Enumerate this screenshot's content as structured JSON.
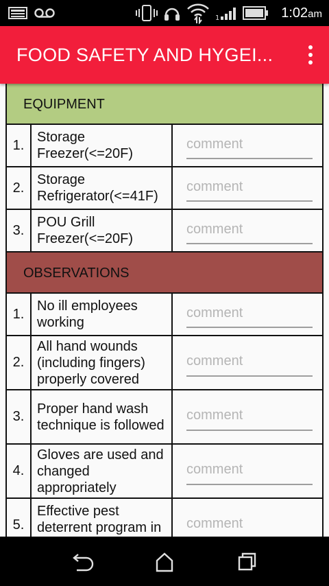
{
  "status_bar": {
    "time": "1:02",
    "ampm": "am"
  },
  "app_bar": {
    "title": "FOOD SAFETY AND HYGEI..."
  },
  "sections": [
    {
      "title": "EQUIPMENT",
      "color": "#b3cc82",
      "items": [
        {
          "num": "1.",
          "text": "Storage Freezer(<=20F)",
          "comment_placeholder": "comment",
          "comment_value": ""
        },
        {
          "num": "2.",
          "text": "Storage Refrigerator(<=41F)",
          "comment_placeholder": "comment",
          "comment_value": ""
        },
        {
          "num": "3.",
          "text": "POU Grill Freezer(<=20F)",
          "comment_placeholder": "comment",
          "comment_value": ""
        }
      ]
    },
    {
      "title": "OBSERVATIONS",
      "color": "#a04d49",
      "items": [
        {
          "num": "1.",
          "text": "No ill employees working",
          "comment_placeholder": "comment",
          "comment_value": ""
        },
        {
          "num": "2.",
          "text": "All hand wounds (including fingers) properly covered",
          "comment_placeholder": "comment",
          "comment_value": ""
        },
        {
          "num": "3.",
          "text": "Proper hand wash technique is followed",
          "comment_placeholder": "comment",
          "comment_value": ""
        },
        {
          "num": "4.",
          "text": "Gloves are used and changed appropriately",
          "comment_placeholder": "comment",
          "comment_value": ""
        },
        {
          "num": "5.",
          "text": "Effective pest deterrent program in",
          "comment_placeholder": "comment",
          "comment_value": ""
        }
      ]
    }
  ],
  "colors": {
    "app_bar": "#f21e3b",
    "status_bar": "#000000",
    "nav_bar": "#000000"
  },
  "icons": {
    "status_left": [
      "notification-image-icon",
      "voicemail-icon"
    ],
    "status_right": [
      "vibrate-icon",
      "headset-icon",
      "wifi-icon",
      "signal-icon",
      "battery-icon"
    ],
    "nav": [
      "back-icon",
      "home-icon",
      "recents-icon"
    ]
  }
}
